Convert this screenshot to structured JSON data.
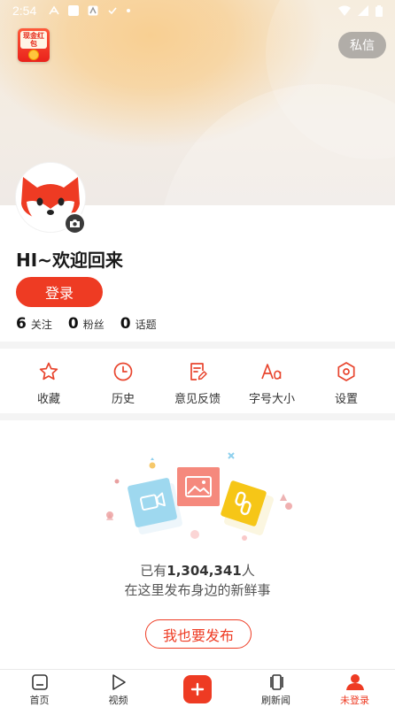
{
  "status_bar": {
    "time": "2:54"
  },
  "hongbao": {
    "label": "现金红包"
  },
  "header": {
    "message_button": "私信"
  },
  "profile": {
    "greeting": "HI~欢迎回来",
    "login_button": "登录",
    "stats": [
      {
        "value": "6",
        "label": "关注"
      },
      {
        "value": "0",
        "label": "粉丝"
      },
      {
        "value": "0",
        "label": "话题"
      }
    ]
  },
  "tools": [
    {
      "label": "收藏",
      "icon": "star-icon"
    },
    {
      "label": "历史",
      "icon": "clock-icon"
    },
    {
      "label": "意见反馈",
      "icon": "feedback-icon"
    },
    {
      "label": "字号大小",
      "icon": "font-size-icon"
    },
    {
      "label": "设置",
      "icon": "settings-icon"
    }
  ],
  "empty_state": {
    "prefix": "已有",
    "count": "1,304,341",
    "suffix": "人",
    "line2": "在这里发布身边的新鲜事",
    "publish_button": "我也要发布"
  },
  "bottom_nav": [
    {
      "label": "首页",
      "icon": "home-icon"
    },
    {
      "label": "视频",
      "icon": "play-icon"
    },
    {
      "label": "",
      "icon": "plus-icon"
    },
    {
      "label": "刷新闻",
      "icon": "cards-icon"
    },
    {
      "label": "未登录",
      "icon": "user-icon",
      "active": true
    }
  ],
  "colors": {
    "accent": "#ee3b23",
    "tool_icon": "#e8452e"
  }
}
